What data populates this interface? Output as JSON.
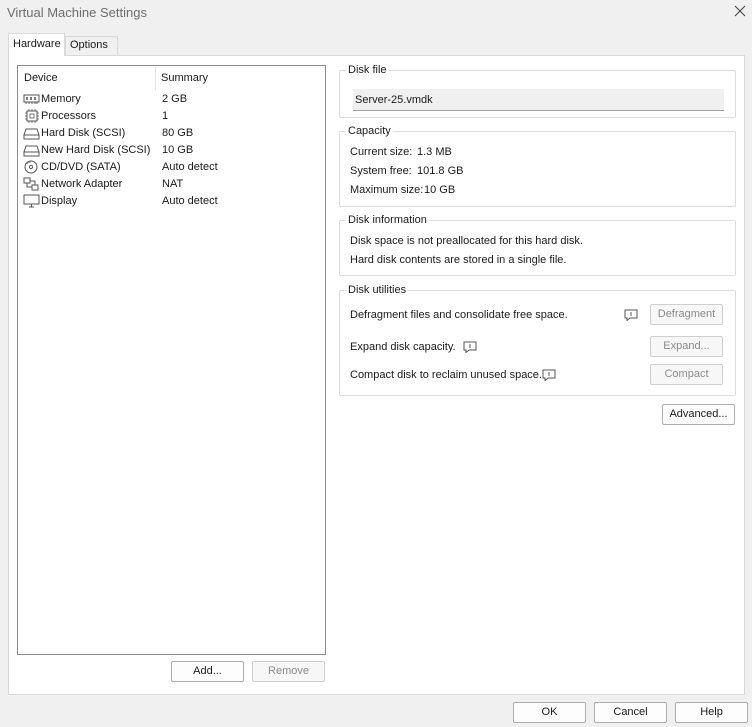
{
  "window": {
    "title": "Virtual Machine Settings"
  },
  "tabs": [
    {
      "label": "Hardware",
      "active": true
    },
    {
      "label": "Options",
      "active": false
    }
  ],
  "device_table": {
    "headers": {
      "device": "Device",
      "summary": "Summary"
    },
    "rows": [
      {
        "icon": "memory-icon",
        "name": "Memory",
        "summary": "2 GB"
      },
      {
        "icon": "processor-icon",
        "name": "Processors",
        "summary": "1"
      },
      {
        "icon": "hard-disk-icon",
        "name": "Hard Disk (SCSI)",
        "summary": "80 GB"
      },
      {
        "icon": "hard-disk-icon",
        "name": "New Hard Disk (SCSI)",
        "summary": "10 GB"
      },
      {
        "icon": "cd-dvd-icon",
        "name": "CD/DVD (SATA)",
        "summary": "Auto detect"
      },
      {
        "icon": "network-adapter-icon",
        "name": "Network Adapter",
        "summary": "NAT"
      },
      {
        "icon": "display-icon",
        "name": "Display",
        "summary": "Auto detect"
      }
    ]
  },
  "device_buttons": {
    "add": "Add...",
    "remove": "Remove"
  },
  "disk_file": {
    "label": "Disk file",
    "value": "Server-25.vmdk"
  },
  "capacity": {
    "label": "Capacity",
    "current_label": "Current size:",
    "current_value": "1.3 MB",
    "free_label": "System free:",
    "free_value": "101.8 GB",
    "max_label": "Maximum size:",
    "max_value": "10 GB"
  },
  "disk_info": {
    "label": "Disk information",
    "line1": "Disk space is not preallocated for this hard disk.",
    "line2": "Hard disk contents are stored in a single file."
  },
  "disk_utilities": {
    "label": "Disk utilities",
    "defrag_text": "Defragment files and consolidate free space.",
    "defrag_button": "Defragment",
    "expand_text": "Expand disk capacity.",
    "expand_button": "Expand...",
    "compact_text": "Compact disk to reclaim unused space.",
    "compact_button": "Compact"
  },
  "advanced_button": "Advanced...",
  "footer": {
    "ok": "OK",
    "cancel": "Cancel",
    "help": "Help"
  },
  "colors": {
    "background": "#f0f0f0",
    "panel": "#ffffff",
    "border": "#d9d9d9",
    "disabled_text": "#8a8a8a"
  }
}
